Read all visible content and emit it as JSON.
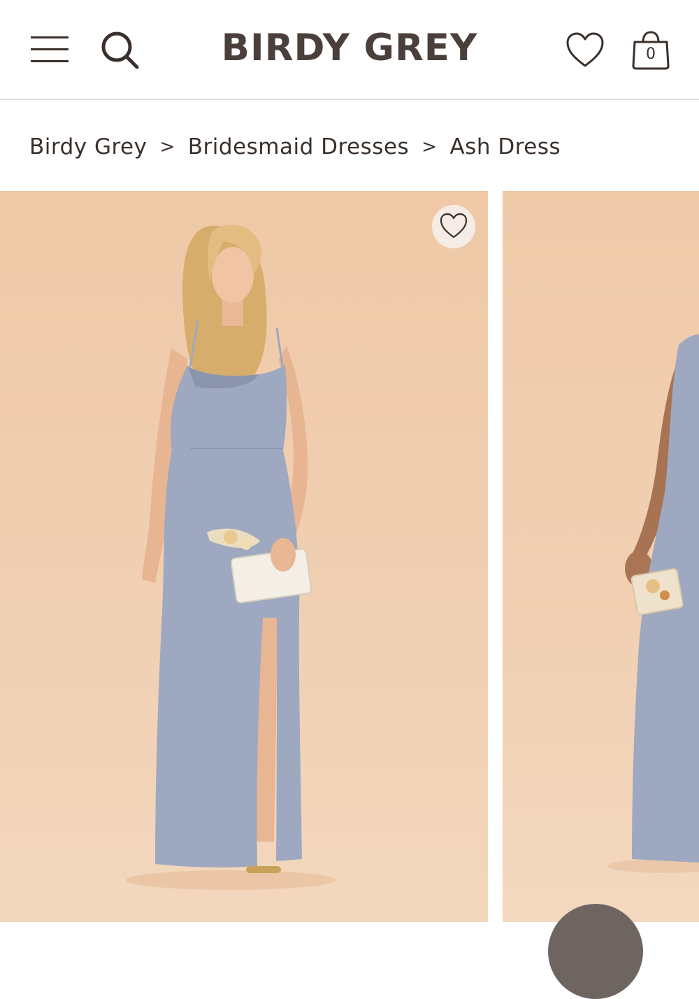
{
  "header": {
    "logo": "BIRDY GREY",
    "cart_count": "0",
    "icons": [
      "menu-icon",
      "search-icon",
      "heart-icon",
      "shopping-bag-icon"
    ]
  },
  "breadcrumb": {
    "items": [
      "Birdy Grey",
      "Bridesmaid Dresses",
      "Ash Dress"
    ],
    "separator": ">"
  },
  "gallery": {
    "images": [
      {
        "name": "model-front-view",
        "has_favorite_button": true
      },
      {
        "name": "model-side-view",
        "has_favorite_button": false
      }
    ]
  },
  "colors": {
    "brand_text": "#4a3f3a",
    "photo_background": "#efc9a7",
    "dress": "#9fa8c0"
  }
}
